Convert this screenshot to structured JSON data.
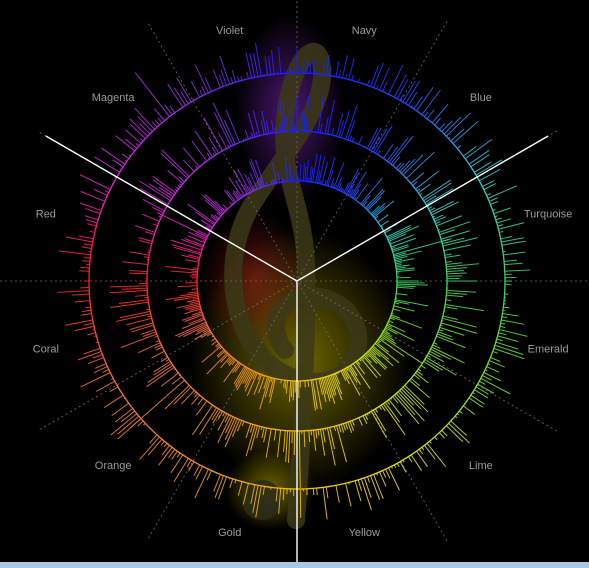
{
  "visualization": {
    "sectors": [
      {
        "label": "Navy",
        "color": "#1020ff"
      },
      {
        "label": "Blue",
        "color": "#2a3cff"
      },
      {
        "label": "Turquoise",
        "color": "#30d0d0"
      },
      {
        "label": "Emerald",
        "color": "#3ad060"
      },
      {
        "label": "Lime",
        "color": "#86e020"
      },
      {
        "label": "Yellow",
        "color": "#e8e010"
      },
      {
        "label": "Gold",
        "color": "#f0c000"
      },
      {
        "label": "Orange",
        "color": "#f09020"
      },
      {
        "label": "Coral",
        "color": "#f07050"
      },
      {
        "label": "Red",
        "color": "#ff2020"
      },
      {
        "label": "Magenta",
        "color": "#e020e0"
      },
      {
        "label": "Violet",
        "color": "#9030e0"
      }
    ],
    "colors": {
      "background": "#000000",
      "label_text": "#9a9a9a",
      "divider_line": "#ffffff",
      "guide_line": "#6a6a6a",
      "bottom_bar": "#a8c8e0"
    },
    "icons": {
      "center_symbol": "treble-clef-icon"
    }
  }
}
